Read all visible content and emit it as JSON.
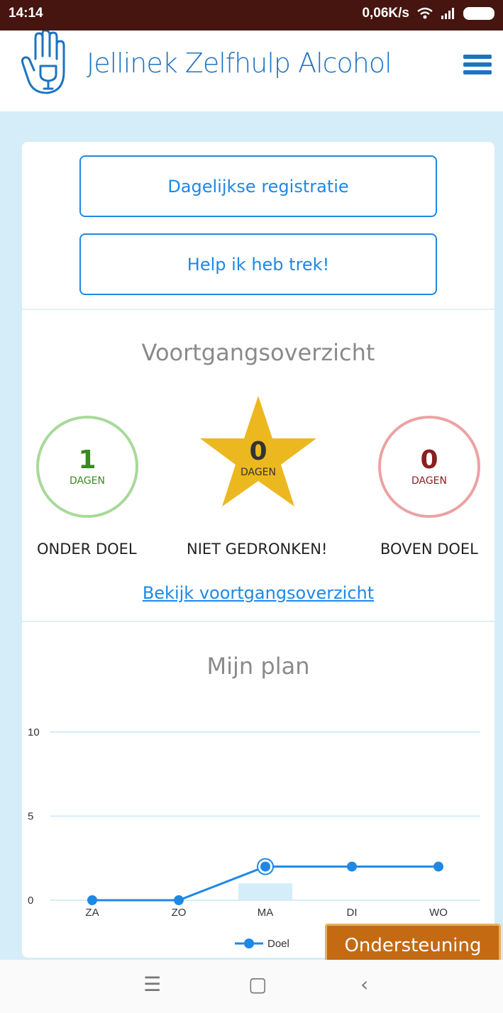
{
  "status": {
    "time": "14:14",
    "speed": "0,06K/s"
  },
  "header": {
    "title": "Jellinek Zelfhulp Alcohol",
    "logo_icon": "hand-glass-icon",
    "menu_icon": "hamburger-icon"
  },
  "actions": {
    "daily": "Dagelijkse registratie",
    "help": "Help ik heb trek!"
  },
  "progress": {
    "title": "Voortgangsoverzicht",
    "under": {
      "value": "1",
      "unit": "DAGEN",
      "label": "ONDER DOEL"
    },
    "none": {
      "value": "0",
      "unit": "DAGEN",
      "label": "NIET GEDRONKEN!"
    },
    "over": {
      "value": "0",
      "unit": "DAGEN",
      "label": "BOVEN DOEL"
    },
    "link": "Bekijk voortgangsoverzicht"
  },
  "plan": {
    "title": "Mijn plan"
  },
  "chart_data": {
    "type": "line",
    "categories": [
      "ZA",
      "ZO",
      "MA",
      "DI",
      "WO"
    ],
    "series": [
      {
        "name": "Doel",
        "values": [
          0,
          0,
          2,
          2,
          2
        ],
        "color": "#1e88e5"
      }
    ],
    "bars": {
      "values": [
        null,
        null,
        1,
        null,
        null
      ],
      "color": "#d4edf8"
    },
    "yticks": [
      "0",
      "5",
      "10"
    ],
    "ylim": [
      0,
      10
    ],
    "grid": true,
    "legend": "bottom"
  },
  "support": {
    "label": "Ondersteuning"
  },
  "nav": {
    "menu": "☰",
    "home": "▢",
    "back": "‹"
  },
  "colors": {
    "brand": "#1e73c0",
    "accent": "#1e88e5",
    "star": "#ecb81f",
    "statusbar": "#461510",
    "support": "#c46a13"
  }
}
